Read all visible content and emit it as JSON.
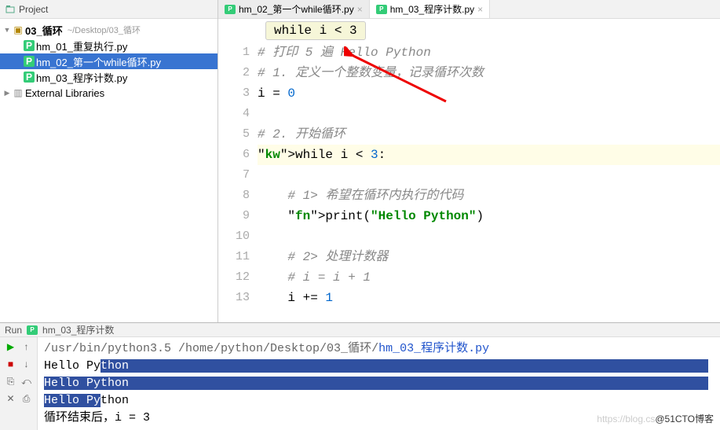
{
  "project": {
    "title": "Project",
    "root_name": "03_循环",
    "root_path": "~/Desktop/03_循环",
    "files": [
      {
        "name": "hm_01_重复执行.py"
      },
      {
        "name": "hm_02_第一个while循环.py",
        "selected": true
      },
      {
        "name": "hm_03_程序计数.py"
      }
    ],
    "external_libs": "External Libraries"
  },
  "tabs": [
    {
      "label": "hm_02_第一个while循环.py",
      "active": false
    },
    {
      "label": "hm_03_程序计数.py",
      "active": true
    }
  ],
  "breadcrumb_chip": "while i < 3",
  "code": {
    "lines": [
      "# 打印 5 遍 Hello Python",
      "# 1. 定义一个整数变量，记录循环次数",
      "i = 0",
      "",
      "# 2. 开始循环",
      "while i < 3:",
      "",
      "    # 1> 希望在循环内执行的代码",
      "    print(\"Hello Python\")",
      "",
      "    # 2> 处理计数器",
      "    # i = i + 1",
      "    i += 1"
    ],
    "highlight_line": 6
  },
  "run": {
    "header_label": "Run",
    "header_config": "hm_03_程序计数",
    "command_path": "/usr/bin/python3.5 /home/python/Desktop/03_循环/",
    "command_file": "hm_03_程序计数.py",
    "output": [
      "Hello Python",
      "Hello Python",
      "Hello Python",
      "循环结束后，i = 3"
    ]
  },
  "watermark_prefix": "https://blog.cs",
  "watermark_suffix": "@51CTO博客"
}
